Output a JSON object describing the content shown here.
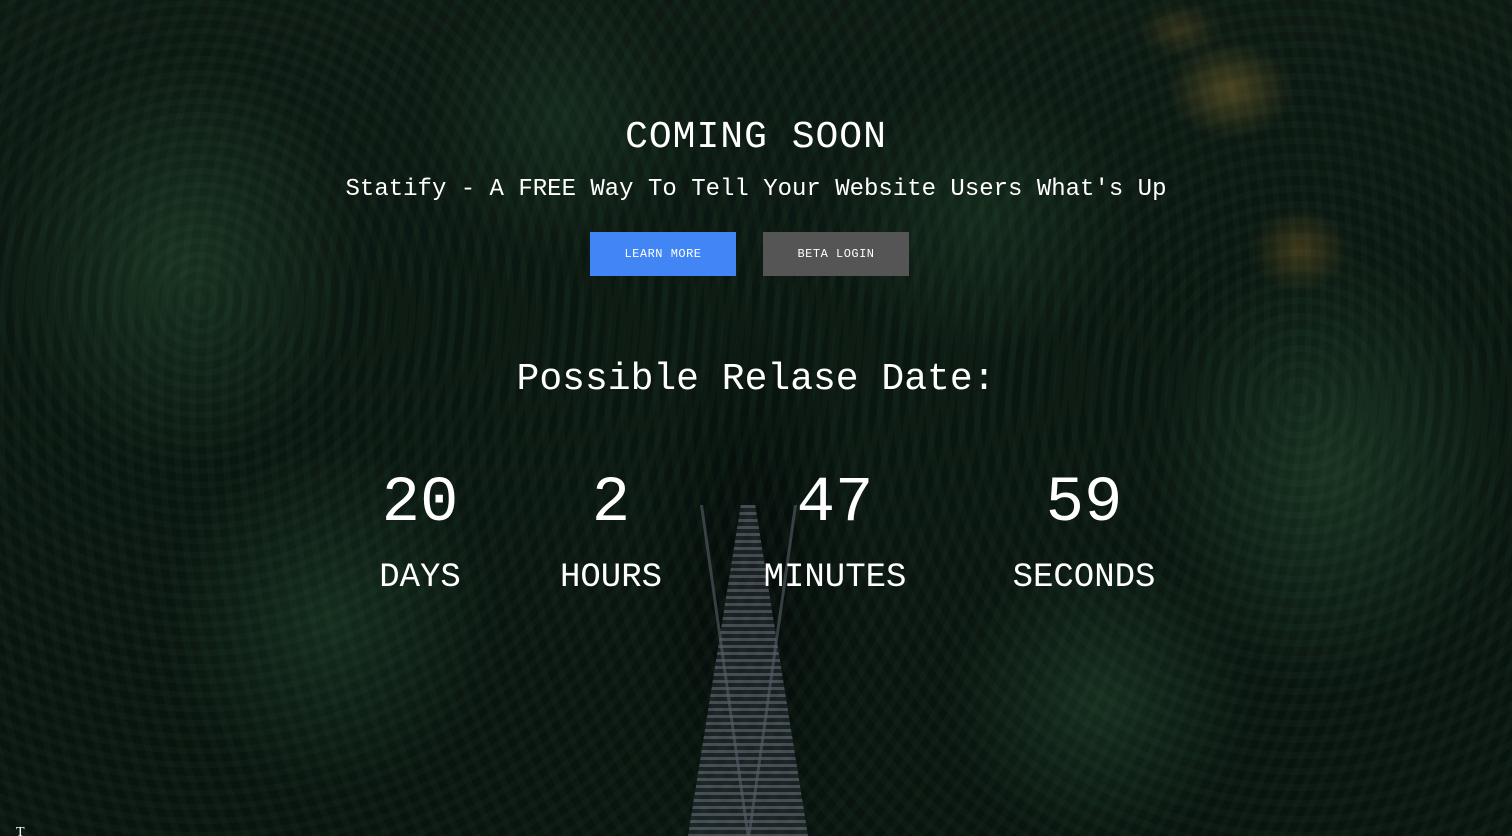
{
  "hero": {
    "title": "COMING SOON",
    "subtitle": "Statify - A FREE Way To Tell Your Website Users What's Up"
  },
  "buttons": {
    "learn_more": "LEARN MORE",
    "beta_login": "BETA LOGIN"
  },
  "release": {
    "heading": "Possible Relase Date:"
  },
  "countdown": {
    "days": {
      "value": "20",
      "label": "DAYS"
    },
    "hours": {
      "value": "2",
      "label": "HOURS"
    },
    "minutes": {
      "value": "47",
      "label": "MINUTES"
    },
    "seconds": {
      "value": "59",
      "label": "SECONDS"
    }
  },
  "footer": {
    "glyph": "T"
  },
  "colors": {
    "learn_more_bg": "#4285f4",
    "beta_login_bg": "#555555",
    "text": "#ffffff"
  }
}
